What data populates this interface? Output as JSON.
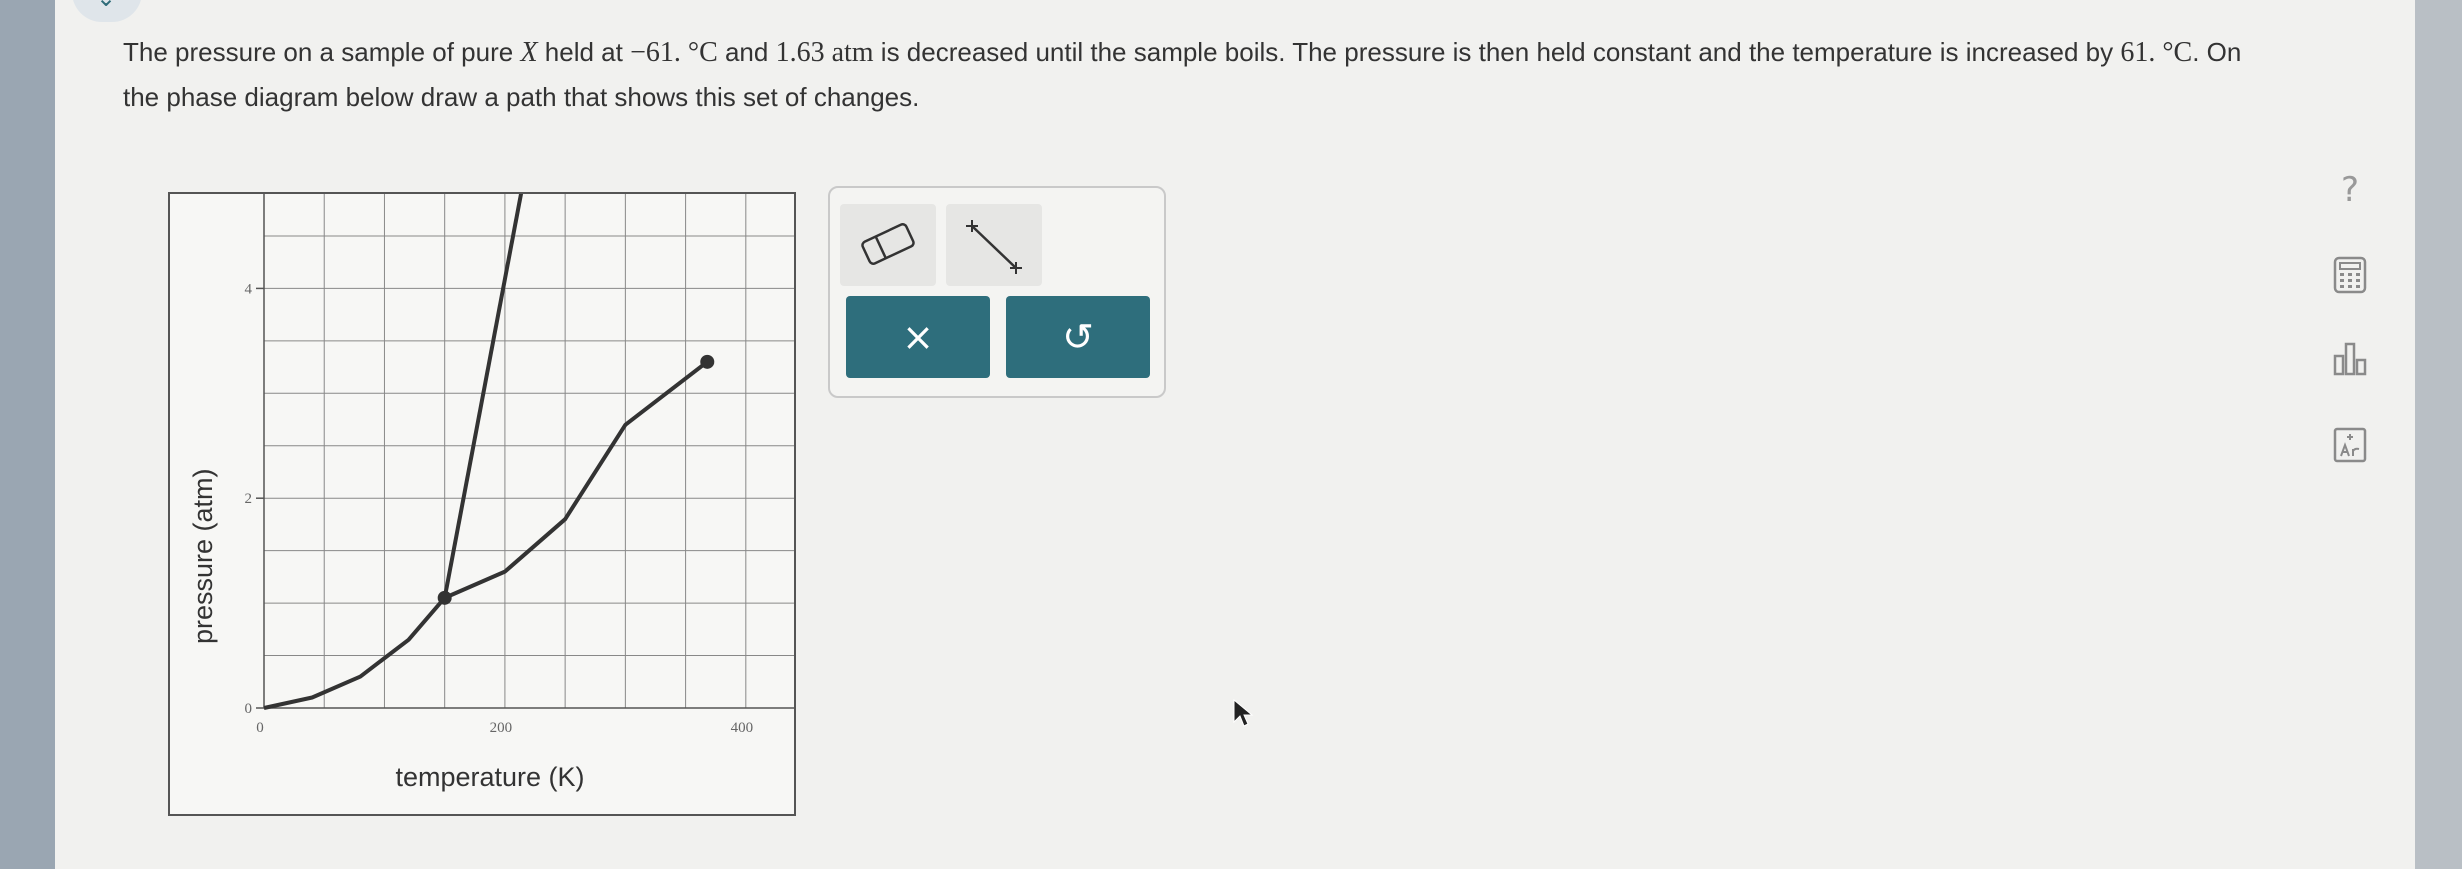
{
  "question": {
    "part1": "The pressure on a sample of pure ",
    "var_x": "X",
    "part2": " held at ",
    "temp1": "−61. °C",
    "part3": " and ",
    "press1": "1.63 atm",
    "part4": " is decreased until the sample boils. The pressure is then held constant and the temperature is increased by ",
    "temp2": "61. °C",
    "part5": ". On the phase diagram below draw a path that shows this set of changes."
  },
  "graph": {
    "xlabel": "temperature (K)",
    "ylabel": "pressure (atm)",
    "x_ticks": [
      "0",
      "200",
      "400"
    ],
    "y_ticks": [
      "0",
      "2",
      "4"
    ]
  },
  "chart_data": {
    "type": "line",
    "xlabel": "temperature (K)",
    "ylabel": "pressure (atm)",
    "xlim": [
      0,
      440
    ],
    "ylim": [
      0,
      4.9
    ],
    "grid": true,
    "series": [
      {
        "values": [
          [
            0,
            0
          ],
          [
            40,
            0.1
          ],
          [
            80,
            0.3
          ],
          [
            120,
            0.65
          ],
          [
            150,
            1.05
          ]
        ]
      },
      {
        "values": [
          [
            150,
            1.05
          ],
          [
            215,
            5
          ]
        ]
      },
      {
        "values": [
          [
            150,
            1.05
          ],
          [
            200,
            1.3
          ],
          [
            250,
            1.8
          ],
          [
            300,
            2.7
          ],
          [
            368,
            3.3
          ]
        ]
      }
    ],
    "points": [
      [
        150,
        1.05
      ],
      [
        368,
        3.3
      ]
    ]
  },
  "toolbox": {
    "eraser": "eraser-icon",
    "line": "line-icon",
    "clear_label": "×",
    "undo_label": "↺"
  },
  "side_tools": {
    "help_label": "?"
  },
  "colors": {
    "accent": "#2e6e7c",
    "curve": "#333333",
    "grid": "#888888",
    "background": "#f1f1ef"
  }
}
